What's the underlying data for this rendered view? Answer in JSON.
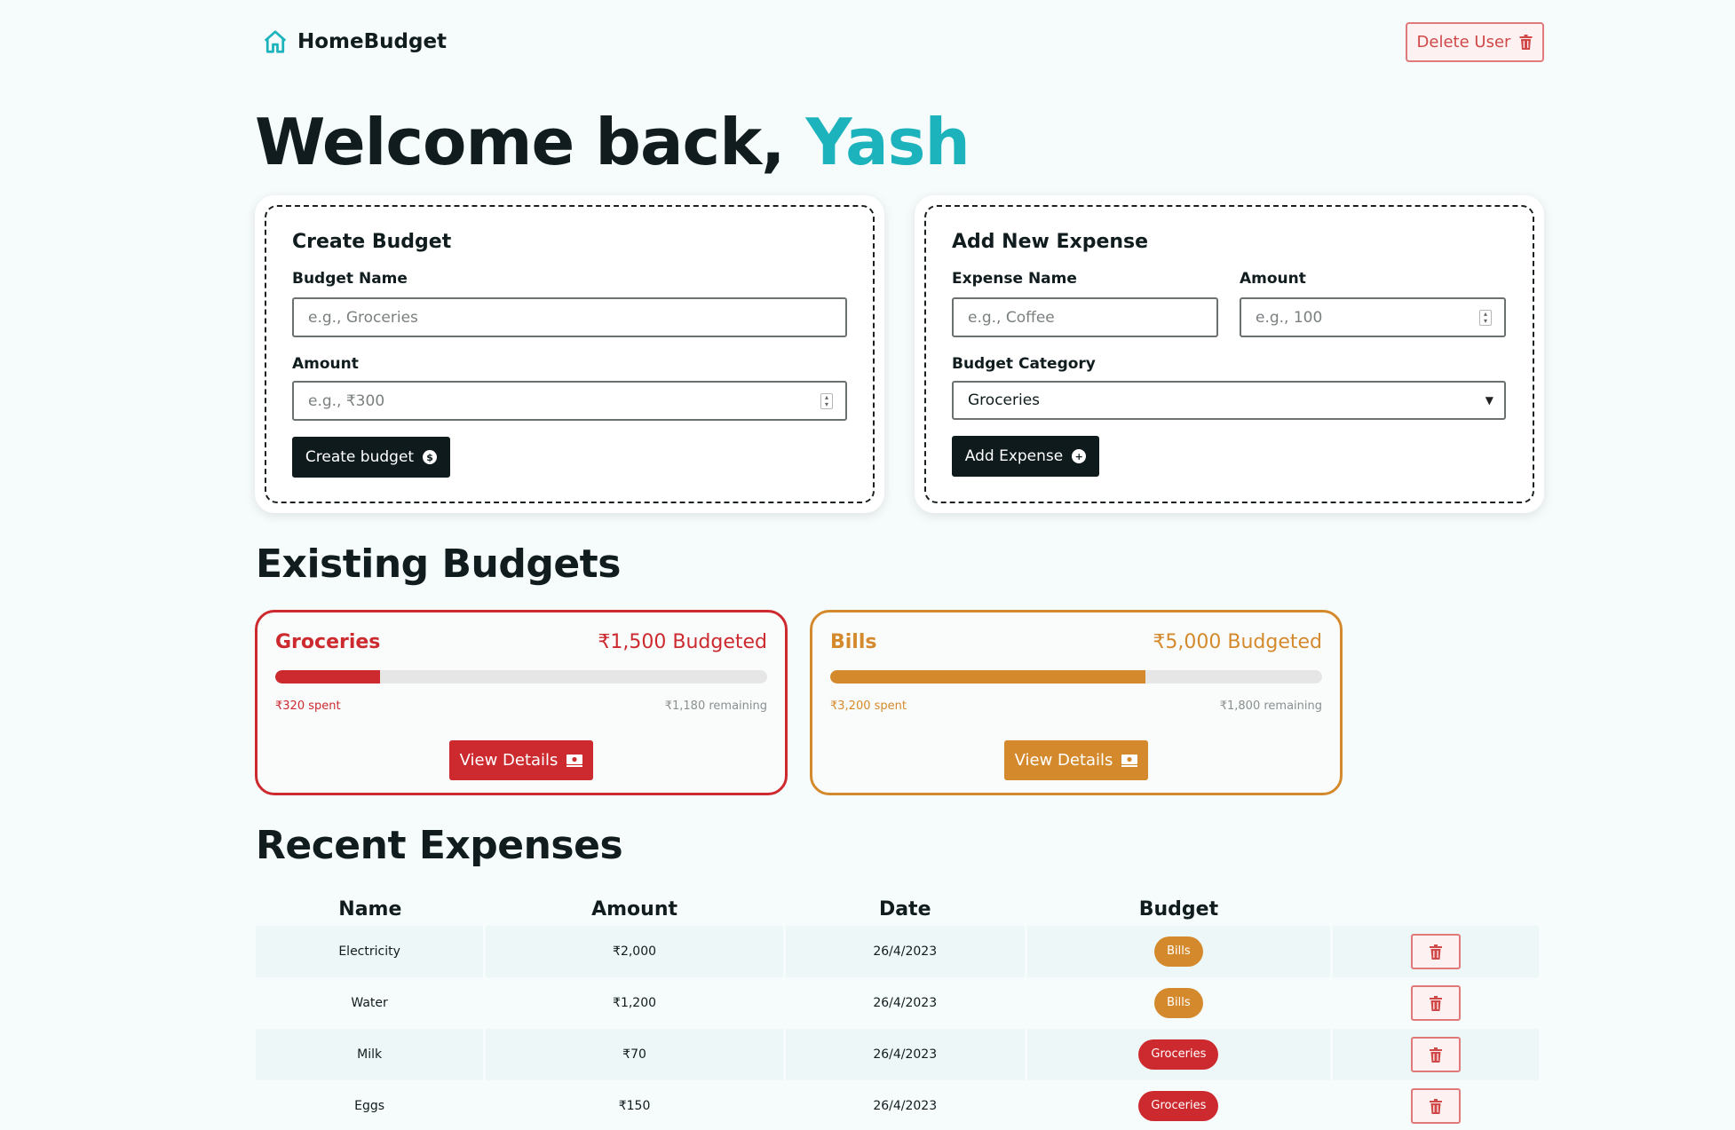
{
  "nav": {
    "brand": "HomeBudget",
    "delete_user_label": "Delete User"
  },
  "welcome": {
    "prefix": "Welcome back, ",
    "user": "Yash"
  },
  "create_budget": {
    "title": "Create Budget",
    "name_label": "Budget Name",
    "name_placeholder": "e.g., Groceries",
    "amount_label": "Amount",
    "amount_placeholder": "e.g., ₹300",
    "button_label": "Create budget"
  },
  "add_expense": {
    "title": "Add New Expense",
    "name_label": "Expense Name",
    "name_placeholder": "e.g., Coffee",
    "amount_label": "Amount",
    "amount_placeholder": "e.g., 100",
    "category_label": "Budget Category",
    "category_selected": "Groceries",
    "button_label": "Add Expense"
  },
  "budgets_heading": "Existing Budgets",
  "budgets": [
    {
      "name": "Groceries",
      "budgeted": "₹1,500 Budgeted",
      "spent": "₹320 spent",
      "remaining": "₹1,180 remaining",
      "progress": 0.213,
      "color": "#cd2a2f",
      "button_label": "View Details"
    },
    {
      "name": "Bills",
      "budgeted": "₹5,000 Budgeted",
      "spent": "₹3,200 spent",
      "remaining": "₹1,800 remaining",
      "progress": 0.64,
      "color": "#d48a2c",
      "button_label": "View Details"
    }
  ],
  "expenses_heading": "Recent Expenses",
  "expenses_table": {
    "headers": [
      "Name",
      "Amount",
      "Date",
      "Budget",
      ""
    ],
    "rows": [
      {
        "name": "Electricity",
        "amount": "₹2,000",
        "date": "26/4/2023",
        "budget": "Bills"
      },
      {
        "name": "Water",
        "amount": "₹1,200",
        "date": "26/4/2023",
        "budget": "Bills"
      },
      {
        "name": "Milk",
        "amount": "₹70",
        "date": "26/4/2023",
        "budget": "Groceries"
      },
      {
        "name": "Eggs",
        "amount": "₹150",
        "date": "26/4/2023",
        "budget": "Groceries"
      }
    ]
  },
  "colors": {
    "accent": "#1db3bd",
    "dark": "#0e1a1c",
    "danger": "#d04848",
    "groceries": "#cd2a2f",
    "bills": "#d48a2c"
  }
}
